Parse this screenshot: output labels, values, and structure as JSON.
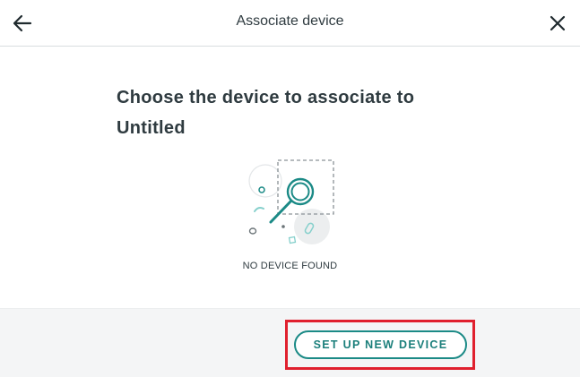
{
  "dialog": {
    "title": "Associate device",
    "back_icon": "arrow-left-icon",
    "close_icon": "close-icon"
  },
  "main": {
    "heading": "Choose the device to associate to Untitled",
    "empty_state": {
      "icon": "magnifier-illustration-icon",
      "label": "NO DEVICE FOUND"
    }
  },
  "footer": {
    "primary_button": "SET UP NEW DEVICE"
  },
  "colors": {
    "accent": "#1b8a86",
    "highlight_border": "#e0202e",
    "footer_bg": "#f4f5f6",
    "text": "#2f3b40"
  }
}
